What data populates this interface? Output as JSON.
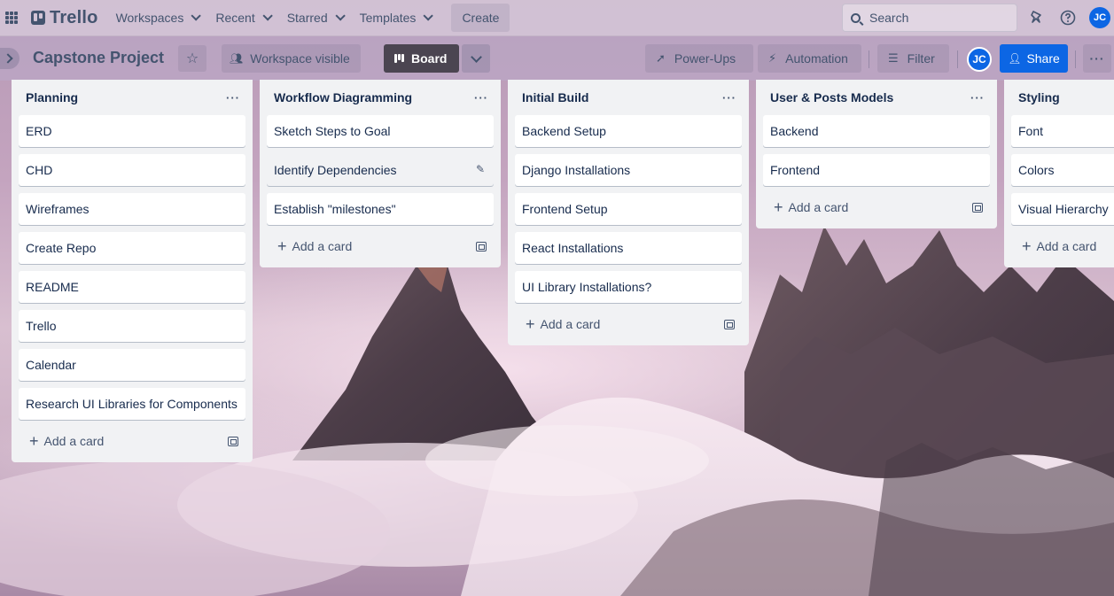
{
  "topnav": {
    "logo": "Trello",
    "menus": [
      "Workspaces",
      "Recent",
      "Starred",
      "Templates"
    ],
    "create": "Create",
    "search_placeholder": "Search",
    "avatar": "JC"
  },
  "board": {
    "title": "Capstone Project",
    "visibility": "Workspace visible",
    "view": "Board",
    "powerups": "Power-Ups",
    "automation": "Automation",
    "filter": "Filter",
    "avatar": "JC",
    "share": "Share",
    "more": "···"
  },
  "lists": [
    {
      "title": "Planning",
      "menu": "···",
      "add": "Add a card",
      "cards": [
        "ERD",
        "CHD",
        "Wireframes",
        "Create Repo",
        "README",
        "Trello",
        "Calendar",
        "Research UI Libraries for Components"
      ]
    },
    {
      "title": "Workflow Diagramming",
      "menu": "···",
      "add": "Add a card",
      "cards": [
        "Sketch Steps to Goal",
        "Identify Dependencies",
        "Establish \"milestones\""
      ]
    },
    {
      "title": "Initial Build",
      "menu": "···",
      "add": "Add a card",
      "cards": [
        "Backend Setup",
        "Django Installations",
        "Frontend Setup",
        "React Installations",
        "UI Library Installations?"
      ]
    },
    {
      "title": "User & Posts Models",
      "menu": "···",
      "add": "Add a card",
      "cards": [
        "Backend",
        "Frontend"
      ]
    },
    {
      "title": "Styling",
      "menu": "···",
      "add": "Add a card",
      "cards": [
        "Font",
        "Colors",
        "Visual Hierarchy"
      ]
    }
  ],
  "colors": {
    "accent": "#0c66e4",
    "list_bg": "#f1f2f4",
    "board_view": "#4b4551"
  }
}
